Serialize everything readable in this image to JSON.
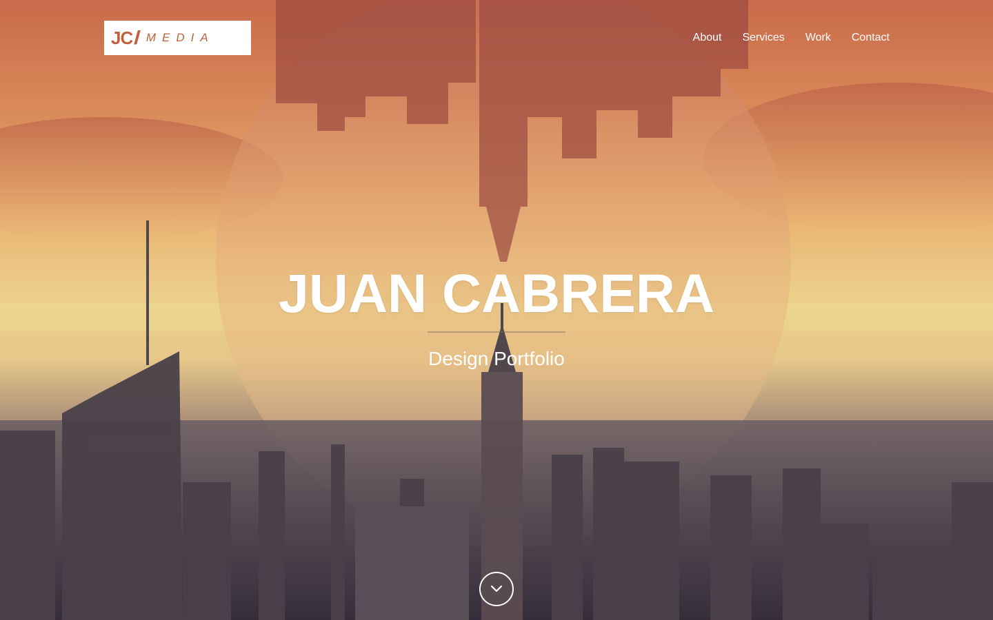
{
  "brand": {
    "logo_mark": "JC",
    "logo_separator": "//",
    "logo_word": "MEDIA",
    "accent_color": "#c0623e"
  },
  "nav": {
    "items": [
      {
        "label": "About"
      },
      {
        "label": "Services"
      },
      {
        "label": "Work"
      },
      {
        "label": "Contact"
      }
    ]
  },
  "hero": {
    "title": "JUAN CABRERA",
    "subtitle": "Design Portfolio",
    "scroll_icon": "chevron-down-icon"
  }
}
